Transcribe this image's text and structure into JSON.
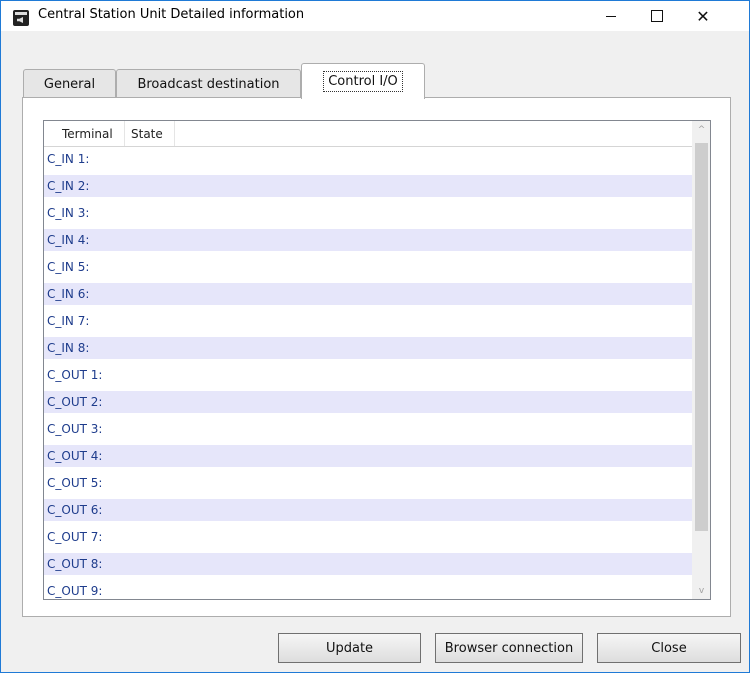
{
  "window": {
    "title": "Central Station Unit Detailed information",
    "icon": "app-speaker-icon",
    "caption": {
      "minimize": "minimize-icon",
      "maximize": "maximize-icon",
      "close_glyph": "✕"
    }
  },
  "tabs": [
    {
      "label": "General",
      "selected": false
    },
    {
      "label": "Broadcast destination",
      "selected": false
    },
    {
      "label": "Control I/O",
      "selected": true
    }
  ],
  "list": {
    "columns": [
      "Terminal",
      "State"
    ],
    "rows": [
      {
        "terminal": "C_IN 1:",
        "state": ""
      },
      {
        "terminal": "C_IN 2:",
        "state": ""
      },
      {
        "terminal": "C_IN 3:",
        "state": ""
      },
      {
        "terminal": "C_IN 4:",
        "state": ""
      },
      {
        "terminal": "C_IN 5:",
        "state": ""
      },
      {
        "terminal": "C_IN 6:",
        "state": ""
      },
      {
        "terminal": "C_IN 7:",
        "state": ""
      },
      {
        "terminal": "C_IN 8:",
        "state": ""
      },
      {
        "terminal": "C_OUT 1:",
        "state": ""
      },
      {
        "terminal": "C_OUT 2:",
        "state": ""
      },
      {
        "terminal": "C_OUT 3:",
        "state": ""
      },
      {
        "terminal": "C_OUT 4:",
        "state": ""
      },
      {
        "terminal": "C_OUT 5:",
        "state": ""
      },
      {
        "terminal": "C_OUT 6:",
        "state": ""
      },
      {
        "terminal": "C_OUT 7:",
        "state": ""
      },
      {
        "terminal": "C_OUT 8:",
        "state": ""
      },
      {
        "terminal": "C_OUT 9:",
        "state": ""
      }
    ],
    "scroll_up_glyph": "^",
    "scroll_down_glyph": "v"
  },
  "buttons": {
    "update": "Update",
    "browser_connection": "Browser connection",
    "close": "Close"
  },
  "colors": {
    "row_text": "#1e3c8c",
    "alt_row_bg": "#e6e6fa",
    "window_border": "#1f7ad6"
  }
}
